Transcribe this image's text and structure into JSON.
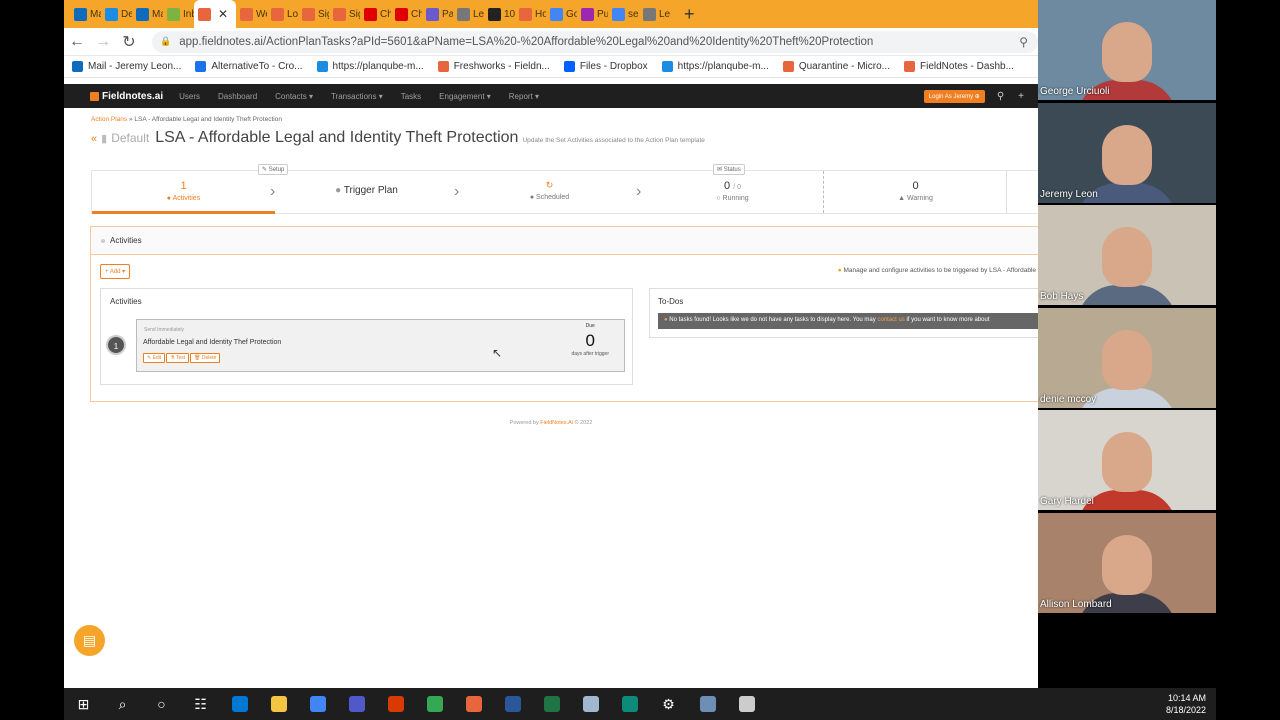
{
  "browser": {
    "tabs": [
      {
        "label": "Mai",
        "color": "#0f6cbd"
      },
      {
        "label": "Dep",
        "color": "#1b8ce3"
      },
      {
        "label": "Mai",
        "color": "#0f6cbd"
      },
      {
        "label": "Inb",
        "color": "#7cb342"
      },
      {
        "label": "",
        "color": "#e8663d",
        "active": true
      },
      {
        "label": "We",
        "color": "#e8663d"
      },
      {
        "label": "Log",
        "color": "#e8663d"
      },
      {
        "label": "Sigr",
        "color": "#e8663d"
      },
      {
        "label": "Sigr",
        "color": "#e8663d"
      },
      {
        "label": "Cha",
        "color": "#e00000"
      },
      {
        "label": "Cha",
        "color": "#e00000"
      },
      {
        "label": "Pay",
        "color": "#6a5acd"
      },
      {
        "label": "Leg",
        "color": "#777777"
      },
      {
        "label": "10+",
        "color": "#222222"
      },
      {
        "label": "Hov",
        "color": "#e8663d"
      },
      {
        "label": "Goc",
        "color": "#4285f4"
      },
      {
        "label": "Pur",
        "color": "#9c27b0"
      },
      {
        "label": "ses",
        "color": "#4285f4"
      },
      {
        "label": "Leg",
        "color": "#777777"
      }
    ],
    "new_tab": "+",
    "url": "app.fieldnotes.ai/ActionPlanTasks?aPId=5601&aPName=LSA%20-%20Affordable%20Legal%20and%20Identity%20Theft%20Protection",
    "bookmarks": [
      {
        "label": "Mail - Jeremy Leon...",
        "color": "#0f6cbd"
      },
      {
        "label": "AlternativeTo - Cro...",
        "color": "#1a73e8"
      },
      {
        "label": "https://planqube-m...",
        "color": "#1b8ce3"
      },
      {
        "label": "Freshworks - Fieldn...",
        "color": "#e8663d"
      },
      {
        "label": "Files - Dropbox",
        "color": "#0061fe"
      },
      {
        "label": "https://planqube-m...",
        "color": "#1b8ce3"
      },
      {
        "label": "Quarantine - Micro...",
        "color": "#e8663d"
      },
      {
        "label": "FieldNotes - Dashb...",
        "color": "#e8663d"
      }
    ]
  },
  "app": {
    "logo": "Fieldnotes.ai",
    "nav": [
      "Users",
      "Dashboard",
      "Contacts ▾",
      "Transactions ▾",
      "Tasks",
      "Engagement ▾",
      "Report ▾"
    ],
    "login_as": "Login As Jeremy ⊕",
    "breadcrumb": {
      "root": "Action Plans",
      "sep": "»",
      "current": "LSA - Affordable Legal and Identity Theft Protection"
    },
    "title": {
      "default": "Default",
      "main": "LSA - Affordable Legal and Identity Theft Protection",
      "subtitle": "Update the Set Activities associated to the Action Plan template"
    },
    "steps": {
      "setup_label": "Setup",
      "status_label": "Status",
      "activities_count": "1",
      "activities_label": "Activities",
      "trigger_label": "Trigger Plan",
      "scheduled_label": "Scheduled",
      "running_count": "0",
      "running_total": "/ 0",
      "running_label": "Running",
      "warning_count": "0",
      "warning_label": "Warning"
    },
    "activities_panel": {
      "header": "Activities",
      "add_button": "+ Add ▾",
      "hint_prefix": "Manage and configure activities to be triggered by LSA - Affordable",
      "list_header": "Activities",
      "items": [
        {
          "index": "1",
          "timing": "Send Immediately",
          "name": "Affordable Legal and Identity Thef Protection",
          "edit": "✎ Edit",
          "test": "⚗ Test",
          "delete": "🗑 Delete",
          "due_label": "Due",
          "due_value": "0",
          "due_suffix": "days after trigger"
        }
      ]
    },
    "todos": {
      "header": "To-Dos",
      "message": "No tasks found! Looks like we do not have any tasks to display here. You may",
      "link": "contact us",
      "message_end": "if you want to know more about"
    },
    "footer": {
      "prefix": "Powered by",
      "brand": "FieldNotes.Ai",
      "suffix": "© 2022"
    }
  },
  "meeting": {
    "participants": [
      {
        "name": "George Urciuoli",
        "bg": "#6d8aa0",
        "shirt": "#b23a3a"
      },
      {
        "name": "Jeremy Leon",
        "bg": "#3b4a55",
        "shirt": "#4a5a7a"
      },
      {
        "name": "Bob Hays",
        "bg": "#c9c2b5",
        "shirt": "#5a6a80"
      },
      {
        "name": "denie mccoy",
        "bg": "#b8a992",
        "shirt": "#c9d2dc"
      },
      {
        "name": "Gary Hardel",
        "bg": "#d8d5ce",
        "shirt": "#c0392b"
      },
      {
        "name": "Allison Lombard",
        "bg": "#a8826a",
        "shirt": "#3e3e4a"
      }
    ]
  },
  "taskbar": {
    "apps": [
      {
        "name": "start",
        "color": "#ffffff"
      },
      {
        "name": "search",
        "color": "#ffffff"
      },
      {
        "name": "cortana",
        "color": "#ffffff"
      },
      {
        "name": "task-view",
        "color": "#ffffff"
      },
      {
        "name": "azure-devops",
        "color": "#0078d4"
      },
      {
        "name": "file-explorer",
        "color": "#f4c542"
      },
      {
        "name": "chrome-profile",
        "color": "#4285f4"
      },
      {
        "name": "teams",
        "color": "#5059c9"
      },
      {
        "name": "office",
        "color": "#d83b01"
      },
      {
        "name": "chrome",
        "color": "#34a853"
      },
      {
        "name": "chrome-app",
        "color": "#e8663d"
      },
      {
        "name": "word",
        "color": "#2b579a"
      },
      {
        "name": "excel",
        "color": "#217346"
      },
      {
        "name": "notepad",
        "color": "#9fb8d0"
      },
      {
        "name": "edge",
        "color": "#0c8b7a"
      },
      {
        "name": "settings",
        "color": "#ffffff"
      },
      {
        "name": "calculator",
        "color": "#6d8fb5"
      },
      {
        "name": "snipping-tool",
        "color": "#cccccc"
      }
    ],
    "time": "10:14 AM",
    "date": "8/18/2022"
  },
  "colors": {
    "accent": "#f07f22",
    "tabbar": "#f4a52a",
    "nav_bg": "#1f1f1f"
  }
}
